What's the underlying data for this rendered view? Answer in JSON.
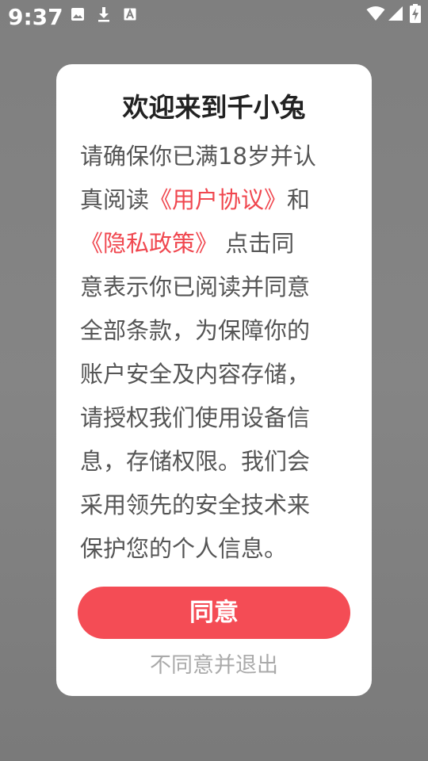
{
  "status_bar": {
    "time": "9:37",
    "left_icons": [
      "image-icon",
      "download-icon",
      "font-a-icon"
    ],
    "right_icons": [
      "wifi-icon",
      "signal-icon",
      "battery-charging-icon"
    ]
  },
  "dialog": {
    "title": "欢迎来到千小兔",
    "body": {
      "line1": "请确保你已满18岁并认",
      "line2_prefix": "真阅读",
      "user_agreement_link": "《用户协议》",
      "line2_suffix": "和",
      "privacy_policy_link": "《隐私政策》",
      "line3_suffix": " 点击同",
      "line4": "意表示你已阅读并同意",
      "line5": "全部条款，为保障你的",
      "line6": "账户安全及内容存储，",
      "line7": "请授权我们使用设备信",
      "line8": "息，存储权限。我们会",
      "line9": "采用领先的安全技术来",
      "line10": "保护您的个人信息。"
    },
    "agree_label": "同意",
    "decline_label": "不同意并退出"
  },
  "colors": {
    "accent": "#f44c55",
    "link": "#f0474f",
    "overlay": "#808080"
  }
}
